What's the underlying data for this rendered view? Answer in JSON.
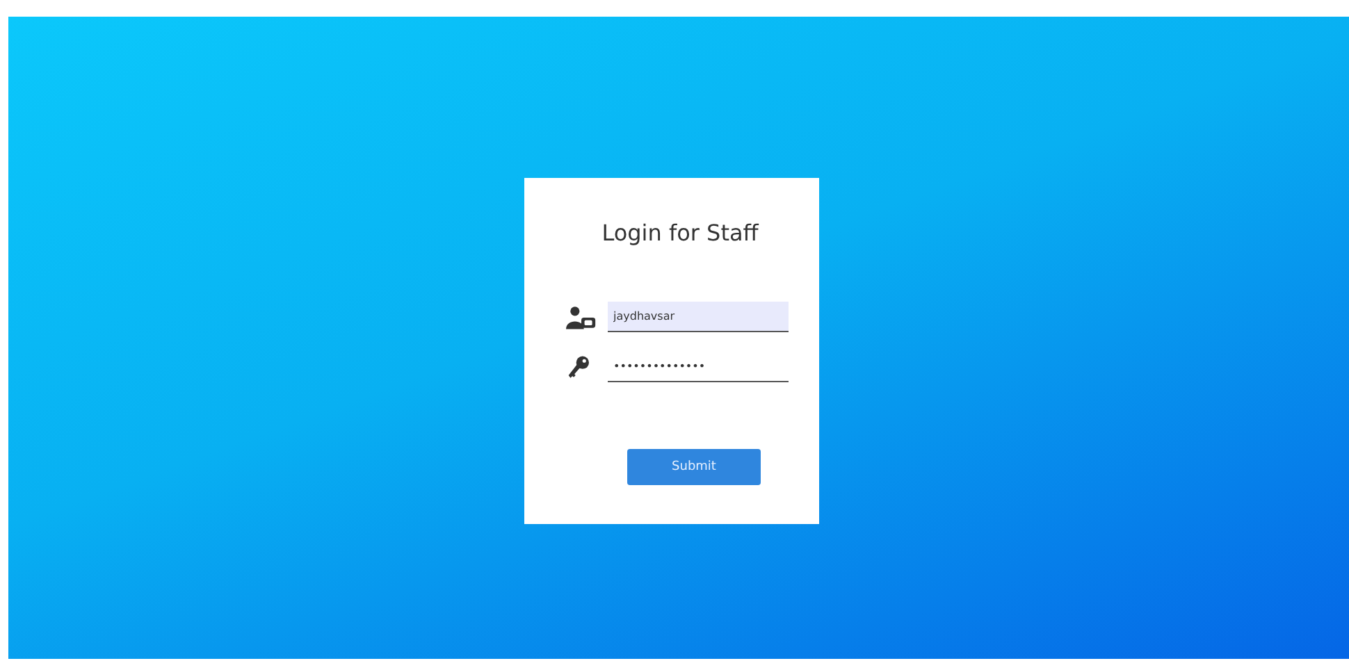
{
  "login_card": {
    "title": "Login for Staff",
    "fields": [
      {
        "kind": "user",
        "value": "jaydhavsar",
        "highlighted": true
      },
      {
        "kind": "password",
        "value": "••••••••••••••",
        "highlighted": false
      }
    ],
    "submit_button": "Submit"
  }
}
